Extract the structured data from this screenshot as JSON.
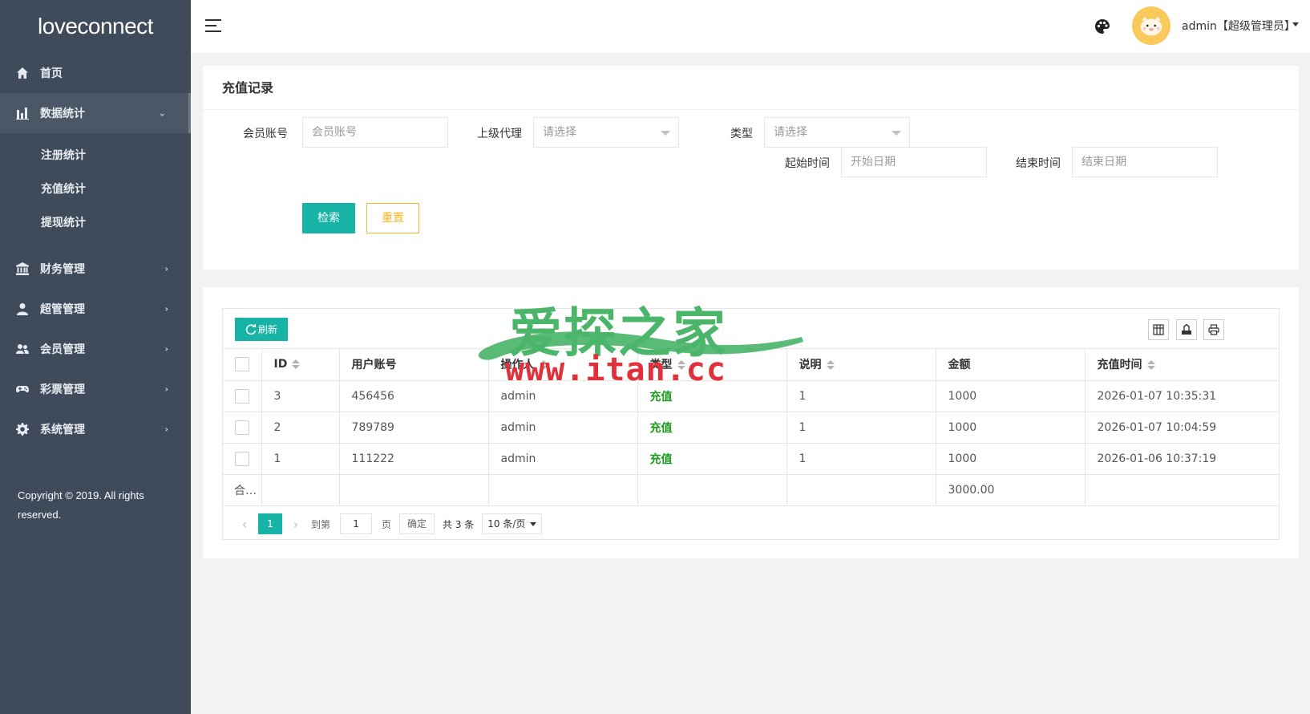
{
  "app": {
    "logo": "loveconnect"
  },
  "sidebar": {
    "items": [
      {
        "label": "首页",
        "icon": "home-icon"
      },
      {
        "label": "数据统计",
        "icon": "bar-chart-icon",
        "arrow": "⌄"
      },
      {
        "label": "财务管理",
        "icon": "bank-icon",
        "arrow": "›"
      },
      {
        "label": "超管管理",
        "icon": "user-icon",
        "arrow": "›"
      },
      {
        "label": "会员管理",
        "icon": "users-icon",
        "arrow": "›"
      },
      {
        "label": "彩票管理",
        "icon": "gamepad-icon",
        "arrow": "›"
      },
      {
        "label": "系统管理",
        "icon": "gear-icon",
        "arrow": "›"
      }
    ],
    "subitems": [
      {
        "label": "注册统计"
      },
      {
        "label": "充值统计"
      },
      {
        "label": "提现统计"
      }
    ],
    "copyright": "Copyright © 2019. All rights reserved."
  },
  "header": {
    "username": "admin【超级管理员】"
  },
  "search": {
    "title": "充值记录",
    "member_label": "会员账号",
    "member_placeholder": "会员账号",
    "agent_label": "上级代理",
    "agent_value": "请选择",
    "type_label": "类型",
    "type_value": "请选择",
    "start_label": "起始时间",
    "start_placeholder": "开始日期",
    "end_label": "结束时间",
    "end_placeholder": "结束日期",
    "search_button": "检索",
    "reset_button": "重置"
  },
  "table": {
    "refresh_label": "刷新",
    "columns": [
      "ID",
      "用户账号",
      "操作人",
      "类型",
      "说明",
      "金额",
      "充值时间"
    ],
    "rows": [
      {
        "id": "3",
        "account": "456456",
        "operator": "admin",
        "type": "充值",
        "note": "1",
        "amount": "1000",
        "time": "2026-01-07 10:35:31"
      },
      {
        "id": "2",
        "account": "789789",
        "operator": "admin",
        "type": "充值",
        "note": "1",
        "amount": "1000",
        "time": "2026-01-07 10:04:59"
      },
      {
        "id": "1",
        "account": "111222",
        "operator": "admin",
        "type": "充值",
        "note": "1",
        "amount": "1000",
        "time": "2026-01-06 10:37:19"
      }
    ],
    "total_label": "合…",
    "total_amount": "3000.00"
  },
  "pager": {
    "current": "1",
    "goto_label": "到第",
    "goto_value": "1",
    "page_label": "页",
    "confirm": "确定",
    "total": "共 3 条",
    "page_size": "10 条/页"
  },
  "watermark": {
    "title": "爱探之家",
    "url": "www.itan.cc"
  },
  "colors": {
    "sidebar": "#3f4a5a",
    "primary": "#16b3a6",
    "warning": "#f7b824",
    "type_green": "#1a9a1a"
  }
}
